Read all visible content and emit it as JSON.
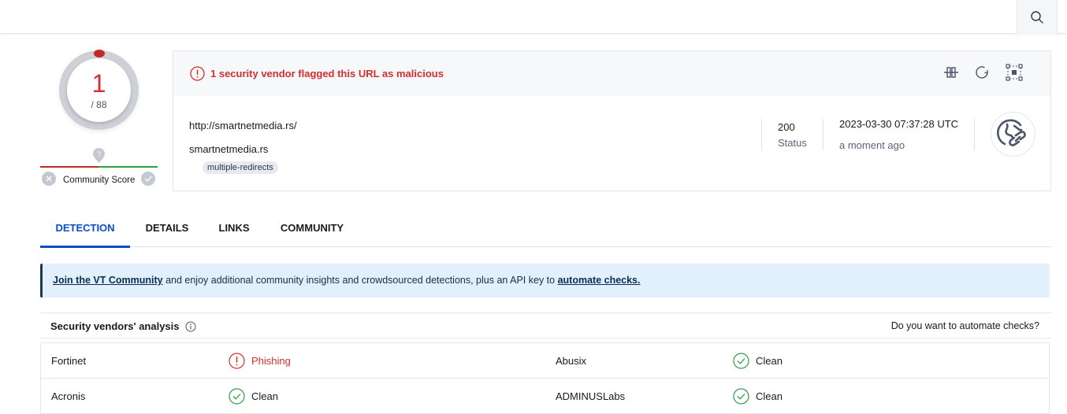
{
  "topbar": {
    "search_icon": "search-icon"
  },
  "score": {
    "detections": "1",
    "total": "/ 88",
    "community_label": "Community Score",
    "community_pin": "?"
  },
  "summary": {
    "alert_text": "1 security vendor flagged this URL as malicious",
    "actions": [
      "compare-icon",
      "reanalyze-icon",
      "graph-icon"
    ],
    "url": "http://smartnetmedia.rs/",
    "domain": "smartnetmedia.rs",
    "tags": [
      "multiple-redirects"
    ],
    "status_code": "200",
    "status_label": "Status",
    "date": "2023-03-30 07:37:28 UTC",
    "relative_date": "a moment ago",
    "type_icon": "url-globe-link-icon"
  },
  "tabs": [
    {
      "label": "DETECTION",
      "active": true
    },
    {
      "label": "DETAILS",
      "active": false
    },
    {
      "label": "LINKS",
      "active": false
    },
    {
      "label": "COMMUNITY",
      "active": false
    }
  ],
  "banner": {
    "link1": "Join the VT Community",
    "middle": " and enjoy additional community insights and crowdsourced detections, plus an API key to ",
    "link2": "automate checks."
  },
  "vendors": {
    "title": "Security vendors' analysis",
    "cta": "Do you want to automate checks?",
    "rows": [
      [
        {
          "vendor": "Fortinet",
          "result": "Phishing",
          "status": "malicious"
        },
        {
          "vendor": "Abusix",
          "result": "Clean",
          "status": "clean"
        }
      ],
      [
        {
          "vendor": "Acronis",
          "result": "Clean",
          "status": "clean"
        },
        {
          "vendor": "ADMINUSLabs",
          "result": "Clean",
          "status": "clean"
        }
      ]
    ]
  },
  "colors": {
    "malicious": "#d32f2f",
    "clean": "#2e9e48",
    "accent": "#0b4dc9"
  }
}
